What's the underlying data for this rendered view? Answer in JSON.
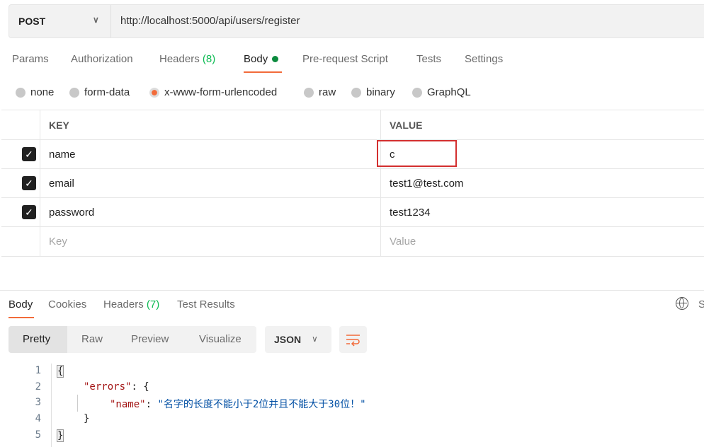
{
  "request": {
    "method": "POST",
    "url": "http://localhost:5000/api/users/register"
  },
  "request_tabs": [
    {
      "label": "Params"
    },
    {
      "label": "Authorization"
    },
    {
      "label": "Headers",
      "count": "(8)"
    },
    {
      "label": "Body"
    },
    {
      "label": "Pre-request Script"
    },
    {
      "label": "Tests"
    },
    {
      "label": "Settings"
    }
  ],
  "body_types": [
    "none",
    "form-data",
    "x-www-form-urlencoded",
    "raw",
    "binary",
    "GraphQL"
  ],
  "selected_body_type": "x-www-form-urlencoded",
  "table": {
    "headers": {
      "key": "KEY",
      "value": "VALUE"
    },
    "rows": [
      {
        "key": "name",
        "value": "c",
        "checked": true
      },
      {
        "key": "email",
        "value": "test1@test.com",
        "checked": true
      },
      {
        "key": "password",
        "value": "test1234",
        "checked": true
      }
    ],
    "placeholder": {
      "key": "Key",
      "value": "Value"
    }
  },
  "response_tabs": [
    {
      "label": "Body"
    },
    {
      "label": "Cookies"
    },
    {
      "label": "Headers",
      "count": "(7)"
    },
    {
      "label": "Test Results"
    }
  ],
  "view_modes": [
    "Pretty",
    "Raw",
    "Preview",
    "Visualize"
  ],
  "format": "JSON",
  "right_cut": "S",
  "code": {
    "l1": "{",
    "l2_key": "\"errors\"",
    "l2_rest": ": {",
    "l3_key": "\"name\"",
    "l3_colon": ": ",
    "l3_val": "\"名字的长度不能小于2位并且不能大于30位！\"",
    "l4": "}",
    "l5": "}",
    "nums": [
      "1",
      "2",
      "3",
      "4",
      "5"
    ]
  },
  "colors": {
    "accent": "#f26b3a",
    "green": "#0cbb52",
    "highlight_box": "#d32f2f"
  }
}
